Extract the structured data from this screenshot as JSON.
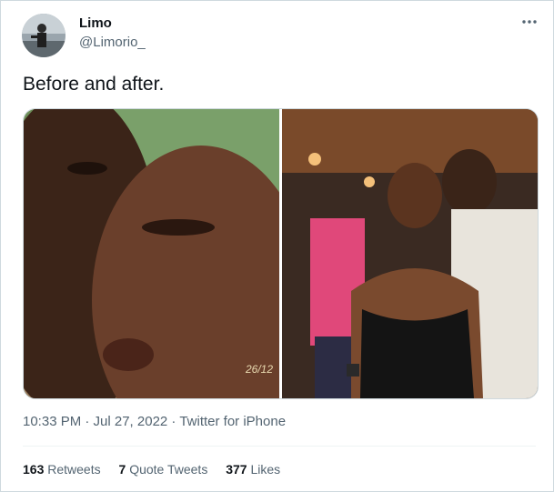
{
  "tweet": {
    "display_name": "Limo",
    "handle": "@Limorio_",
    "text": "Before and after.",
    "image_overlay_text": "26/12",
    "timestamp": "10:33 PM · Jul 27, 2022",
    "separator": " · ",
    "source": "Twitter for iPhone",
    "more_icon": "more-horizontal-icon"
  },
  "stats": {
    "retweets_count": "163",
    "retweets_label": "Retweets",
    "quotes_count": "7",
    "quotes_label": "Quote Tweets",
    "likes_count": "377",
    "likes_label": "Likes"
  },
  "colors": {
    "text": "#0f1419",
    "secondary": "#536471",
    "border": "#cfd9de"
  }
}
